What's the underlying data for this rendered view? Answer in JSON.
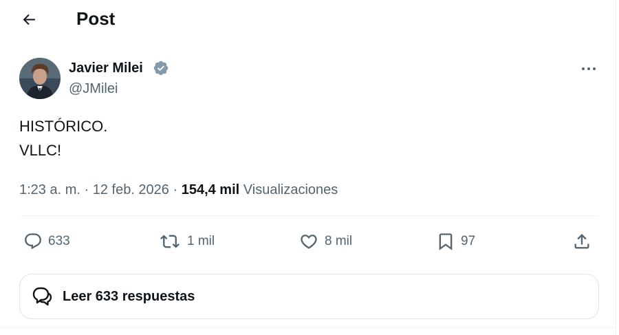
{
  "header": {
    "title": "Post",
    "back_icon": "arrow-left-icon"
  },
  "post": {
    "author_name": "Javier Milei",
    "handle": "@JMilei",
    "verified": true,
    "verified_color": "#829aab",
    "text_lines": [
      "HISTÓRICO.",
      "VLLC!"
    ],
    "timestamp": "1:23 a. m. · 12 feb. 2026",
    "separator": " · ",
    "views_count": "154,4 mil",
    "views_label": " Visualizaciones"
  },
  "actions": {
    "replies": "633",
    "reposts": "1 mil",
    "likes": "8 mil",
    "bookmarks": "97"
  },
  "read_replies": {
    "label": "Leer 633 respuestas"
  },
  "colors": {
    "text_primary": "#0f1419",
    "text_secondary": "#536471",
    "border": "#eff3f4"
  }
}
